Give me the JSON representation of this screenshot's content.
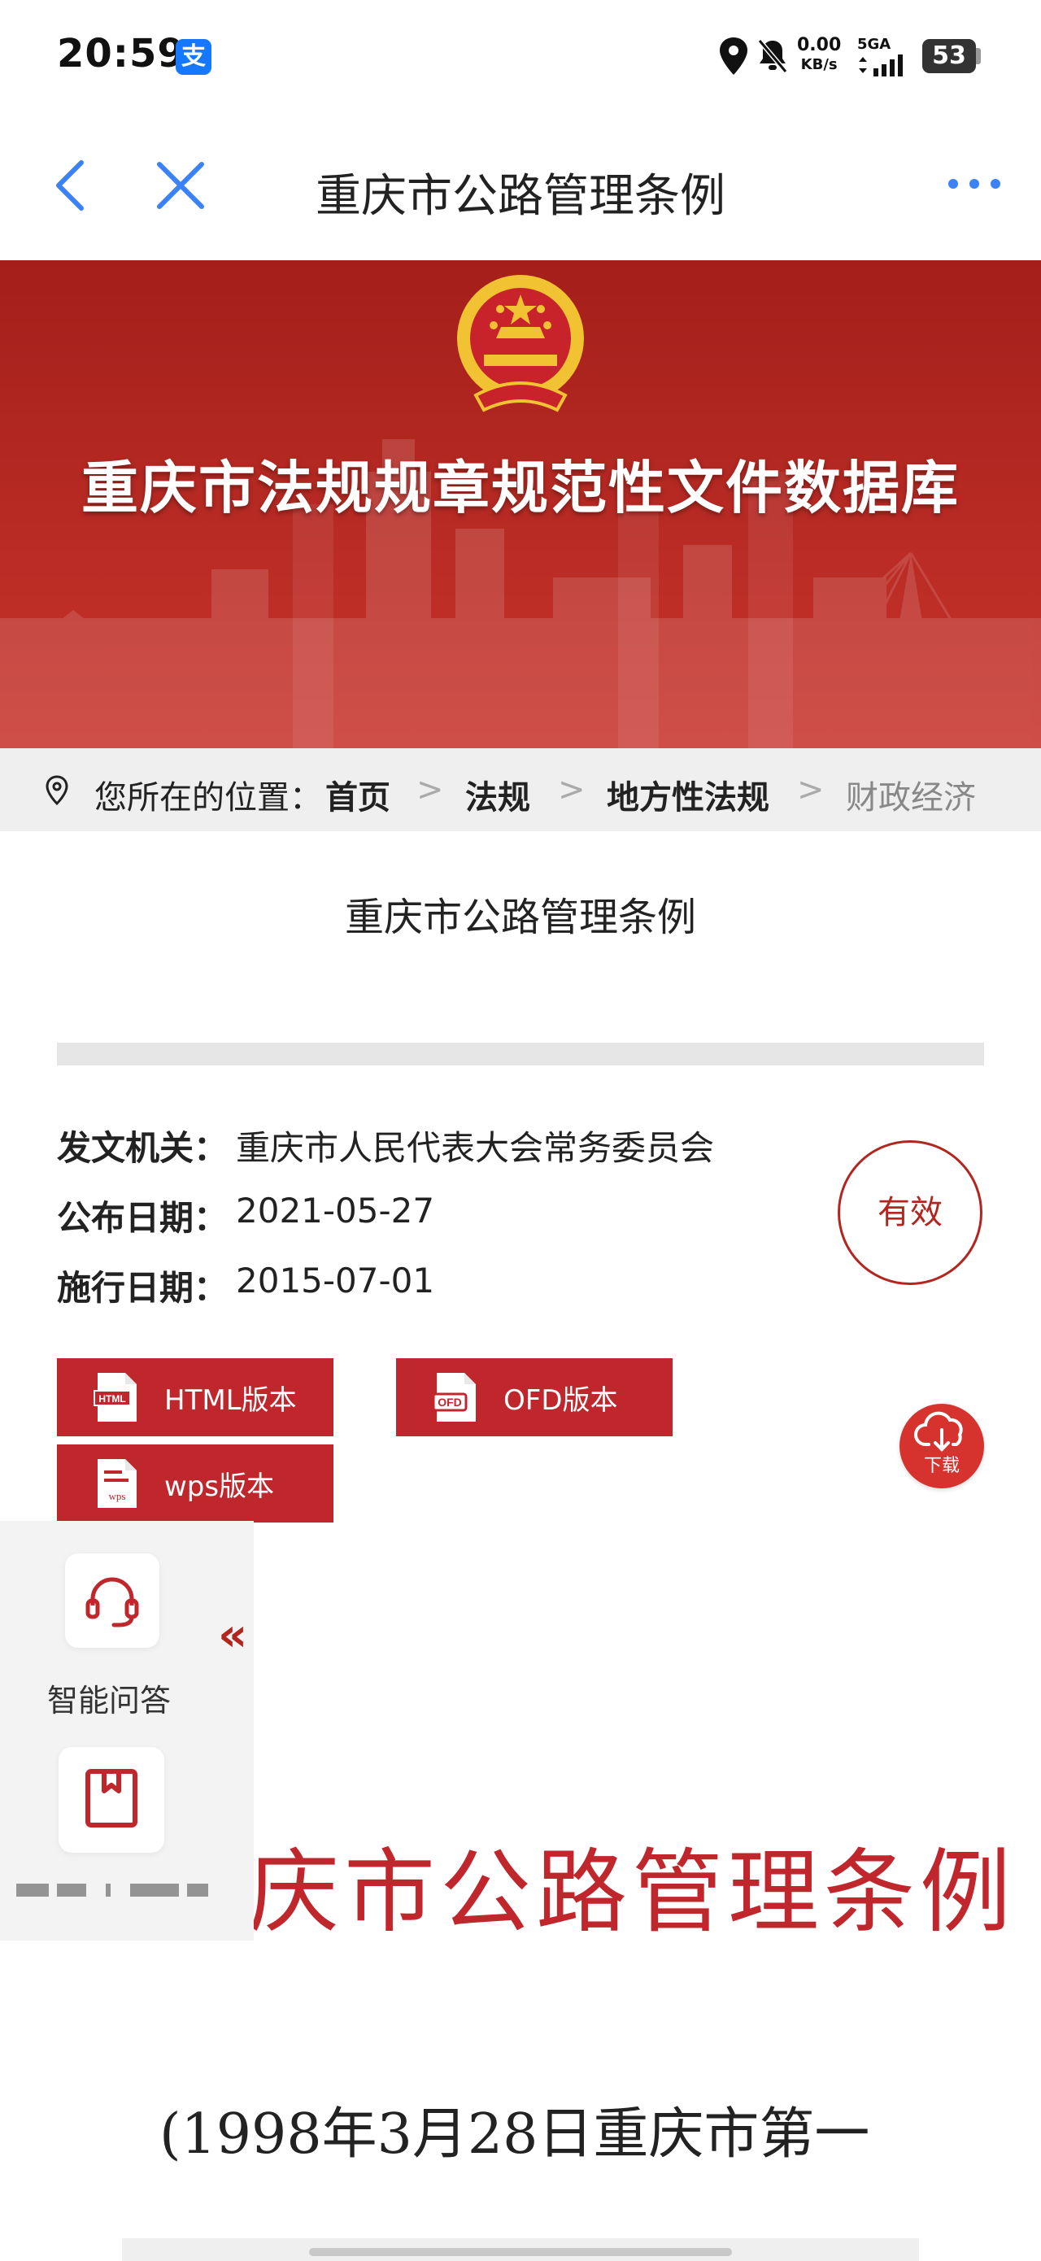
{
  "status_bar": {
    "time": "20:59",
    "app_badge": "支",
    "net_speed_value": "0.00",
    "net_speed_unit": "KB/s",
    "signal_label": "5GA",
    "battery": "53"
  },
  "nav": {
    "title": "重庆市公路管理条例"
  },
  "banner": {
    "title": "重庆市法规规章规范性文件数据库"
  },
  "breadcrumb": {
    "label": "您所在的位置：",
    "items": [
      "首页",
      "法规",
      "地方性法规",
      "财政经济"
    ],
    "separator": ">"
  },
  "document": {
    "title": "重庆市公路管理条例",
    "issuer_label": "发文机关：",
    "issuer_value": "重庆市人民代表大会常务委员会",
    "publish_label": "公布日期：",
    "publish_value": "2021-05-27",
    "effective_label": "施行日期：",
    "effective_value": "2015-07-01",
    "status": "有效"
  },
  "downloads": {
    "html_label": "HTML版本",
    "ofd_label": "OFD版本",
    "wps_label": "wps版本",
    "html_icon_text": "HTML",
    "ofd_icon_text": "OFD",
    "wps_icon_text": "wps",
    "fab_label": "下载"
  },
  "side_panel": {
    "qa_label": "智能问答",
    "collapse": "«"
  },
  "body": {
    "heading": "庆市公路管理条例",
    "line1": "(1998年3月28日重庆市第一"
  },
  "colors": {
    "brand_red": "#b3261f",
    "button_red": "#c0272d",
    "nav_blue": "#3b82f6"
  }
}
